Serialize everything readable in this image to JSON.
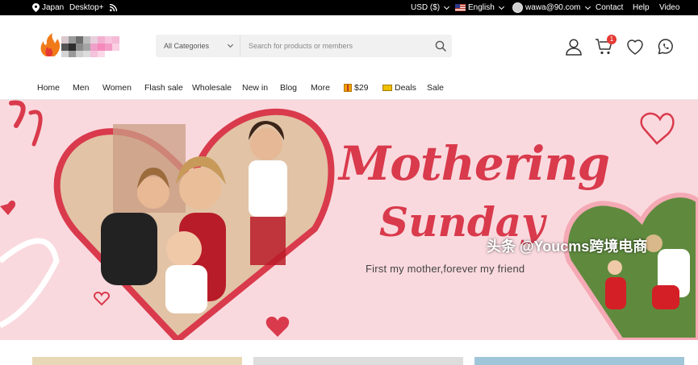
{
  "topbar": {
    "country": "Japan",
    "mode": "Desktop+",
    "currency": "USD ($)",
    "language": "English",
    "user_email": "wawa@90.com",
    "links": [
      "Contact",
      "Help",
      "Video"
    ],
    "icons": [
      "location-pin-icon",
      "rss-icon",
      "us-flag-icon",
      "avatar"
    ]
  },
  "header": {
    "search": {
      "category": "All Categories",
      "placeholder": "Search for products or members"
    },
    "cart_count": "1",
    "icons": [
      "user-icon",
      "cart-icon",
      "heart-icon",
      "whatsapp-icon",
      "search-icon"
    ]
  },
  "nav": {
    "items": [
      "Home",
      "Men",
      "Women",
      "Flash sale",
      "Wholesale",
      "New in",
      "Blog",
      "More",
      "$29",
      "Deals",
      "Sale"
    ]
  },
  "banner": {
    "title_line1": "Mothering",
    "title_line2": "Sunday",
    "tagline": "First my mother,forever my friend"
  },
  "watermark": "头条 @Youcms跨境电商",
  "colors": {
    "topbar": "#000000",
    "banner_bg": "#f9d9de",
    "accent": "#d93a4c",
    "badge": "#e53935"
  }
}
